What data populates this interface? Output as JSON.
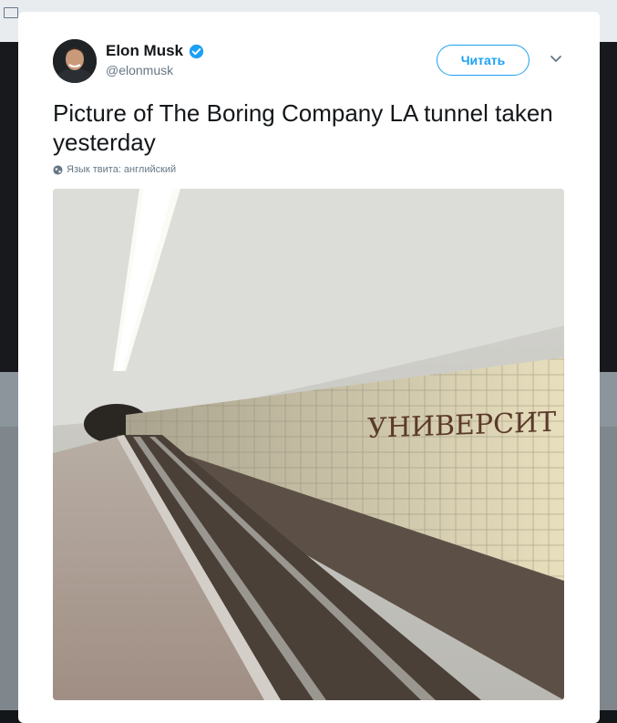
{
  "tweet": {
    "display_name": "Elon Musk",
    "handle": "@elonmusk",
    "follow_label": "Читать",
    "text": "Picture of The Boring Company LA tunnel taken yesterday",
    "language_note": "Язык твита: английский",
    "photo_sign_text": "УНИВЕРСИТ"
  },
  "colors": {
    "accent": "#1da1f2",
    "text_primary": "#14171a",
    "text_secondary": "#657786"
  },
  "icons": {
    "verified": "verified-badge-icon",
    "menu": "chevron-down-icon",
    "globe": "globe-icon",
    "mail": "mail-icon"
  }
}
